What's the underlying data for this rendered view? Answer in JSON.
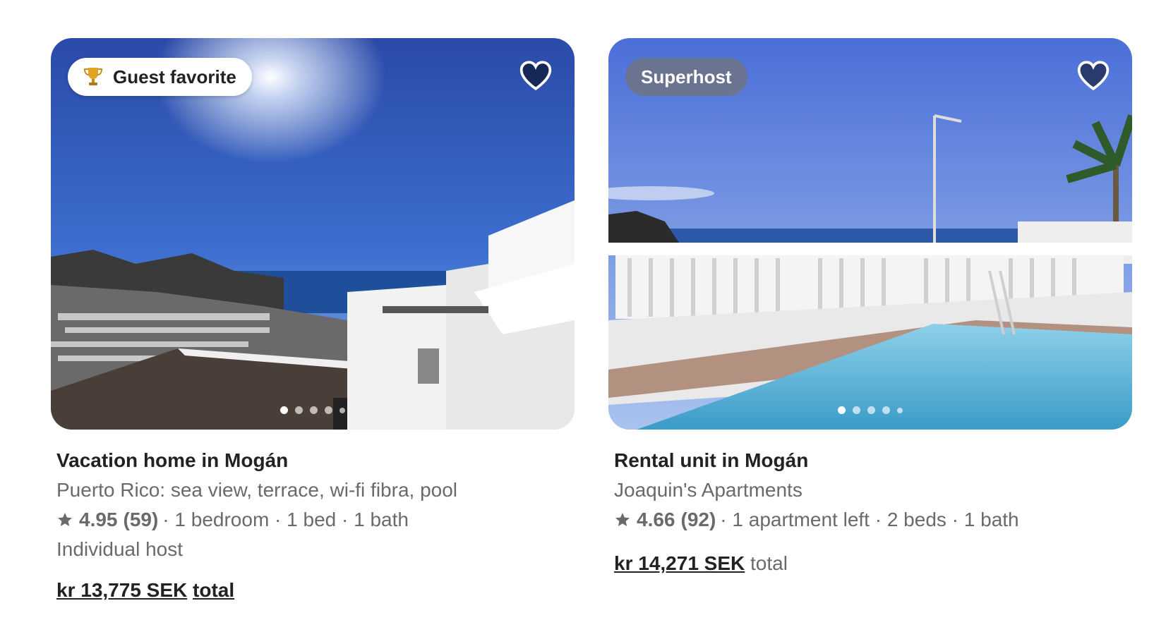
{
  "listings": [
    {
      "badge": "Guest favorite",
      "badge_icon": "trophy-icon",
      "title": "Vacation home in Mogán",
      "subtitle": "Puerto Rico: sea view, terrace, wi-fi fibra, pool",
      "rating": "4.95",
      "reviews": "(59)",
      "details": "· 1 bedroom · 1 bed · 1 bath",
      "host": "Individual host",
      "price": "kr 13,775 SEK",
      "price_suffix": "total",
      "photo_dots": 5,
      "active_dot": 0
    },
    {
      "badge": "Superhost",
      "title": "Rental unit in Mogán",
      "subtitle": "Joaquin's Apartments",
      "rating": "4.66",
      "reviews": "(92)",
      "details": "· 1 apartment left · 2 beds · 1 bath",
      "price": "kr 14,271 SEK",
      "price_suffix": "total",
      "photo_dots": 5,
      "active_dot": 0
    }
  ],
  "colors": {
    "text_primary": "#222222",
    "text_secondary": "#6a6a6a",
    "background": "#ffffff"
  }
}
